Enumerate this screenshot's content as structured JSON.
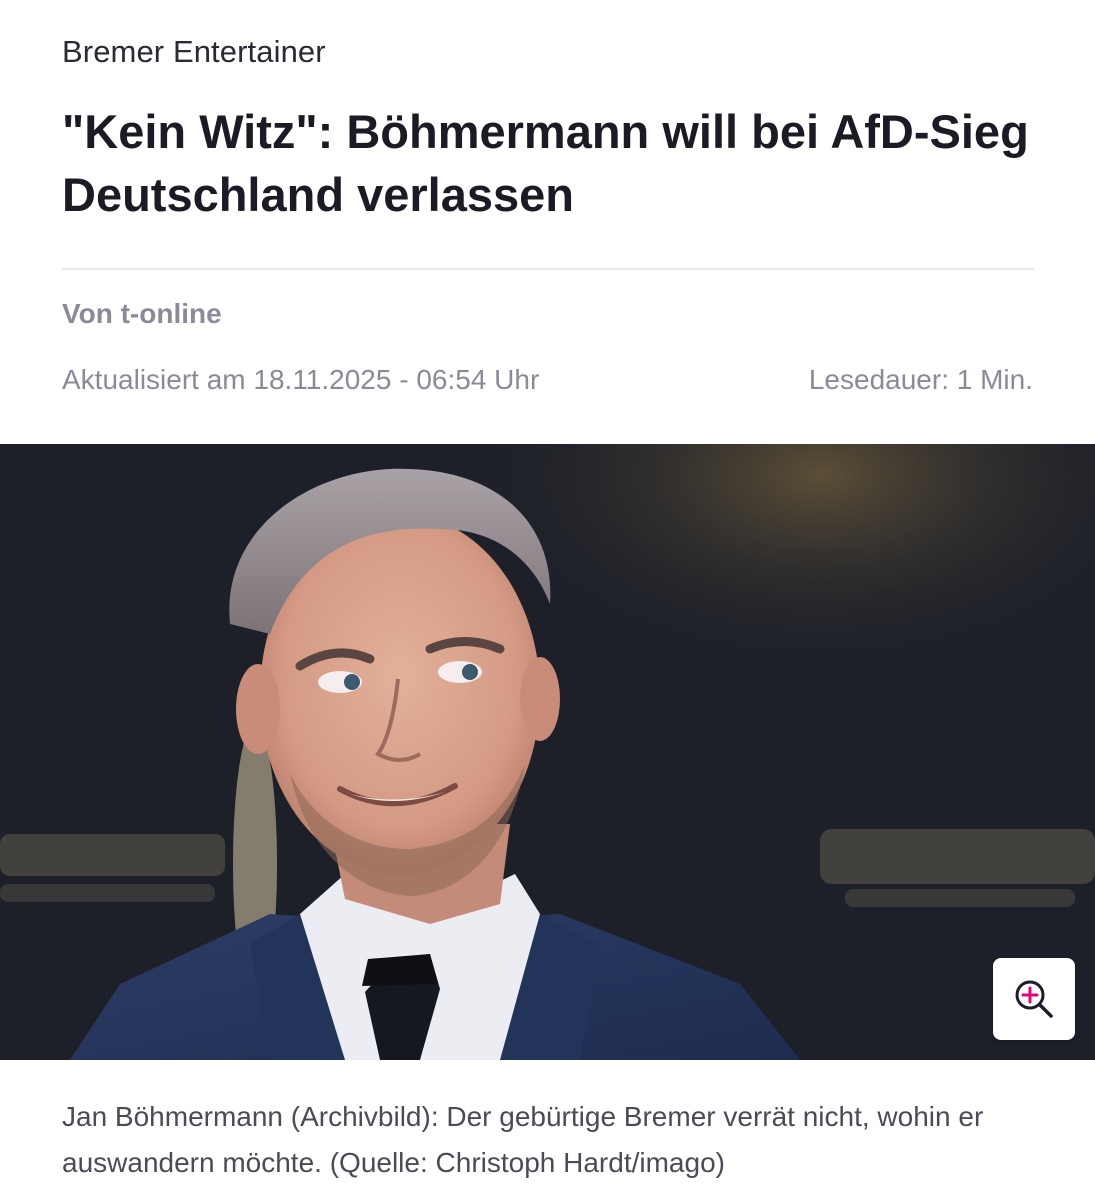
{
  "article": {
    "kicker": "Bremer Entertainer",
    "headline": "\"Kein Witz\": Böhmermann will bei AfD-Sieg Deutschland verlassen",
    "author": "Von t-online",
    "updated": "Aktualisiert am 18.11.2025 - 06:54 Uhr",
    "read_time": "Lesedauer: 1 Min."
  },
  "image": {
    "caption": "Jan Böhmermann (Archivbild): Der gebürtige Bremer verrät nicht, wohin er auswandern möchte. (Quelle: Christoph Hardt/imago)",
    "zoom_icon": "zoom-in-icon",
    "accent_color": "#e5007d"
  }
}
